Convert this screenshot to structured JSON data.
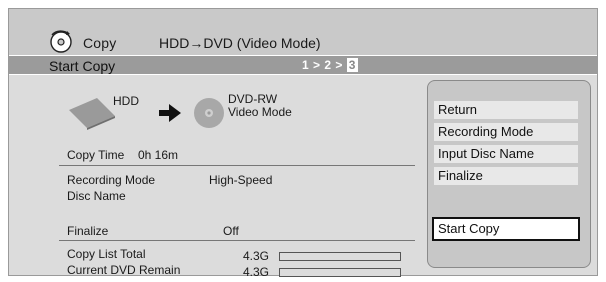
{
  "header": {
    "title": "Copy",
    "mode": "HDD→DVD (Video Mode)",
    "icon": "disc-copy-icon"
  },
  "stepbar": {
    "label": "Start Copy",
    "steps": [
      "1",
      "2",
      "3"
    ],
    "separator": ">",
    "current_step": 3
  },
  "source": {
    "label": "HDD",
    "icon": "hdd-icon"
  },
  "target": {
    "label_line1": "DVD-RW",
    "label_line2": "Video Mode",
    "icon": "dvd-disc-icon"
  },
  "info": {
    "copy_time_label": "Copy Time",
    "copy_time_value": "0h 16m",
    "recording_mode_label": "Recording Mode",
    "recording_mode_value": "High-Speed",
    "disc_name_label": "Disc Name",
    "disc_name_value": "",
    "finalize_label": "Finalize",
    "finalize_value": "Off",
    "copy_list_total_label": "Copy List Total",
    "copy_list_total_value": "4.3G",
    "copy_list_total_fraction": 1.0,
    "current_dvd_remain_label": "Current DVD Remain",
    "current_dvd_remain_value": "4.3G",
    "current_dvd_remain_fraction": 1.0
  },
  "menu": {
    "items": [
      "Return",
      "Recording Mode",
      "Input Disc Name",
      "Finalize"
    ],
    "start": "Start Copy"
  }
}
